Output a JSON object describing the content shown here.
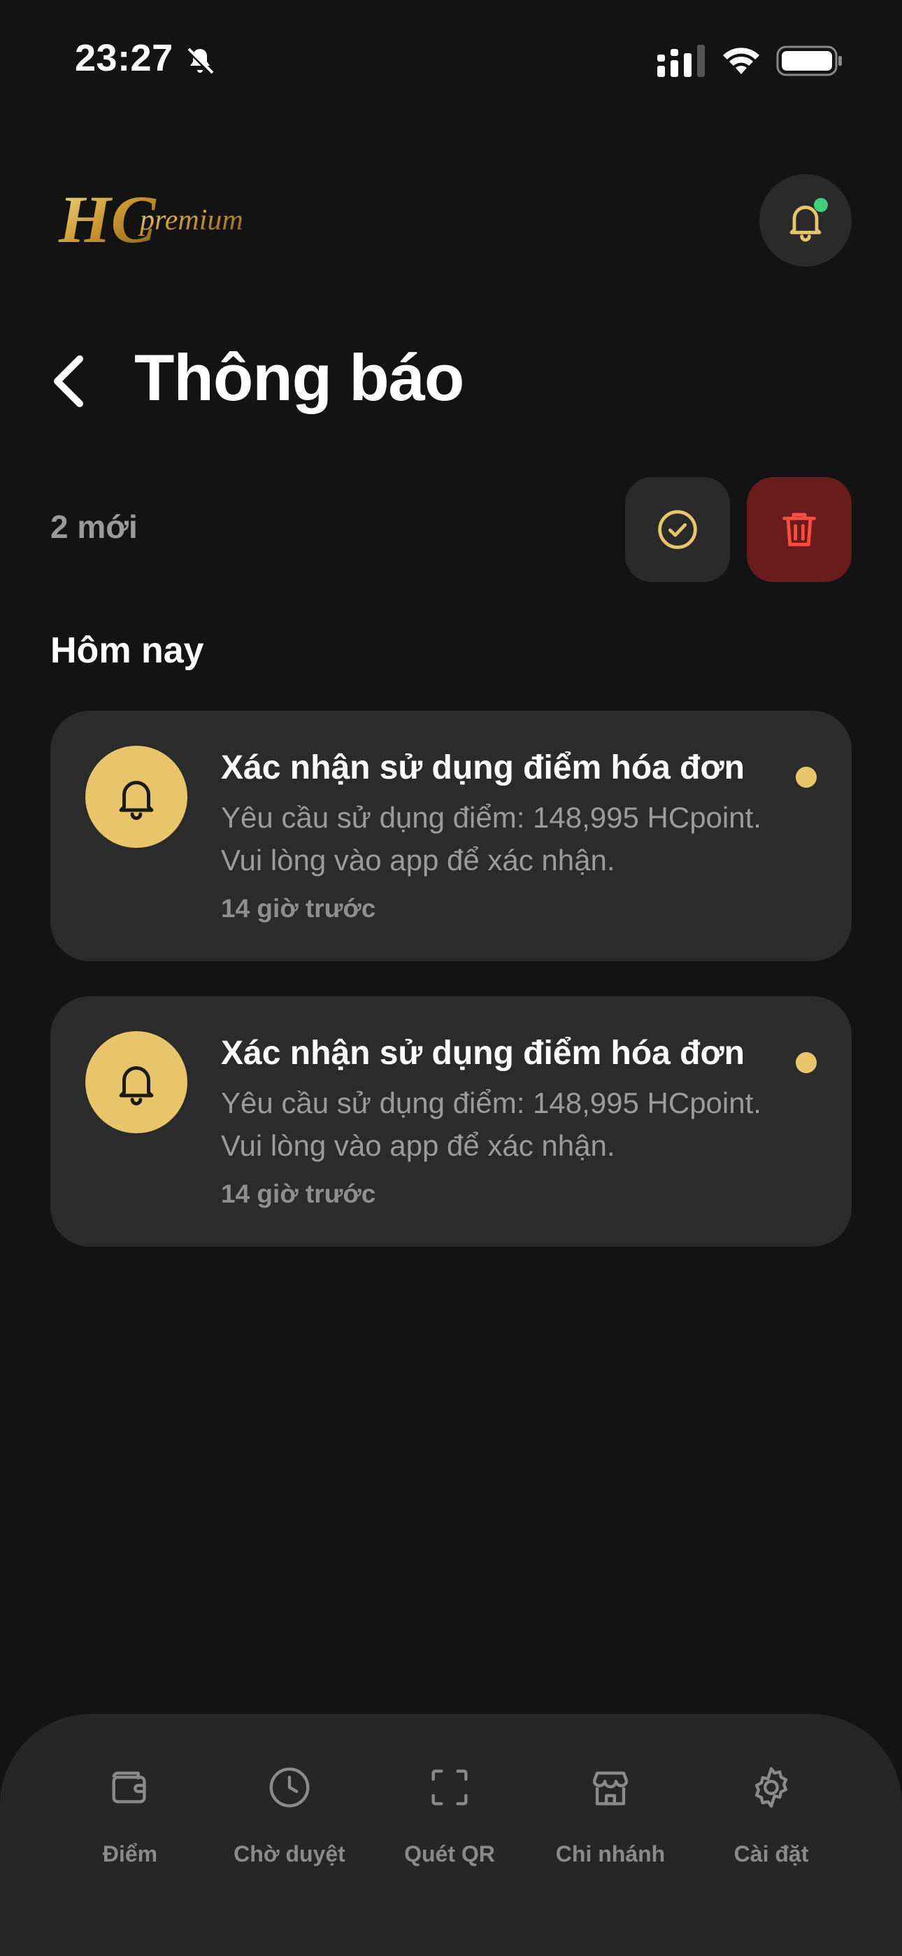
{
  "status_bar": {
    "time": "23:27"
  },
  "header": {
    "logo_text": "HC premium",
    "title": "Thông báo"
  },
  "summary": {
    "new_count": "2 mới"
  },
  "section": {
    "title": "Hôm nay"
  },
  "notifications": [
    {
      "title": "Xác nhận sử dụng điểm hóa đơn",
      "body": "Yêu cầu sử dụng điểm: 148,995 HCpoint. Vui lòng vào app để xác nhận.",
      "time": "14 giờ trước",
      "unread": true
    },
    {
      "title": "Xác nhận sử dụng điểm hóa đơn",
      "body": "Yêu cầu sử dụng điểm: 148,995 HCpoint. Vui lòng vào app để xác nhận.",
      "time": "14 giờ trước",
      "unread": true
    }
  ],
  "bottom_nav": [
    {
      "label": "Điểm",
      "icon": "wallet-icon"
    },
    {
      "label": "Chờ duyệt",
      "icon": "clock-icon"
    },
    {
      "label": "Quét QR",
      "icon": "scan-icon"
    },
    {
      "label": "Chi nhánh",
      "icon": "store-icon"
    },
    {
      "label": "Cài đặt",
      "icon": "gear-icon"
    }
  ],
  "colors": {
    "background": "#131313",
    "card": "#2b2b2b",
    "accent_gold": "#e8c56b",
    "delete_bg": "#6a1c1a",
    "delete_icon": "#ff4d45",
    "online_dot": "#3ed37a"
  }
}
